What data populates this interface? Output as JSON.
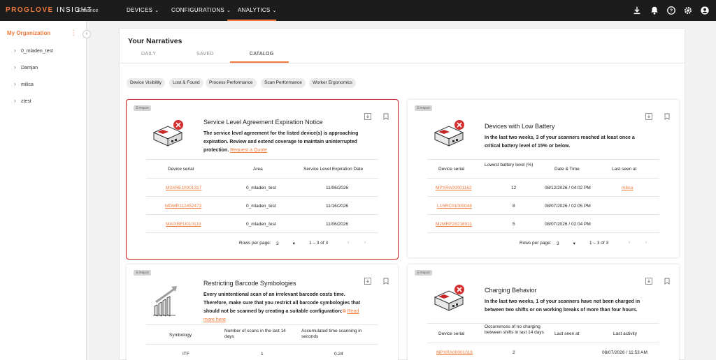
{
  "app": {
    "brand_main": "PROGLOVE",
    "brand_second": "INSIGHT",
    "brand_sub": "Enhance",
    "nav": [
      {
        "label": "DEVICES"
      },
      {
        "label": "CONFIGURATIONS"
      },
      {
        "label": "ANALYTICS"
      }
    ],
    "top_icons": [
      "download-icon",
      "bell-icon",
      "help-icon",
      "gear-icon",
      "user-icon"
    ]
  },
  "sidebar": {
    "org_title": "My Organization",
    "items": [
      {
        "label": "0_mladen_test"
      },
      {
        "label": "Damjan"
      },
      {
        "label": "milica"
      },
      {
        "label": "ztest"
      }
    ]
  },
  "main": {
    "title": "Your Narratives",
    "tabs": [
      {
        "label": "DAILY"
      },
      {
        "label": "SAVED"
      },
      {
        "label": "CATALOG"
      }
    ],
    "chips": [
      "Device Visibility",
      "Lost & Found",
      "Process Performance",
      "Scan Performance",
      "Worker Ergonomics"
    ]
  },
  "cards": {
    "badge": "Report",
    "sla": {
      "title": "Service Level Agreement Expiration Notice",
      "desc_line1": "The service level agreement for the listed device(s) is approaching",
      "desc_line2": "expiration. Review and extend coverage to maintain uninterrupted",
      "desc_line3": "protection.",
      "link": "Request a Quote",
      "columns": [
        "Device serial",
        "Area",
        "Service Level Expiration Date"
      ],
      "rows": [
        {
          "serial": "M3XRE10001317",
          "area": "0_mladen_test",
          "date": "11/06/2026"
        },
        {
          "serial": "MDMR112452473",
          "area": "0_mladen_test",
          "date": "11/16/2026"
        },
        {
          "serial": "MAIXBEU010119",
          "area": "0_mladen_test",
          "date": "11/06/2026"
        }
      ],
      "rows_per_page_label": "Rows per page:",
      "rows_per_page": "3",
      "range": "1 – 3 of 3"
    },
    "battery": {
      "title": "Devices with Low Battery",
      "desc_line1": "In the last two weeks, 3 of your scanners reached at least once a",
      "desc_line2": "critical battery level of 15% or below.",
      "columns": [
        "Device serial",
        "Lowest battery level (%)",
        "Date & Time",
        "Last seen at"
      ],
      "rows": [
        {
          "serial": "MPXRA00001162",
          "level": "12",
          "datetime": "08/12/2026 / 04:02 PM",
          "seen": "milica"
        },
        {
          "serial": "L1SRC01000048",
          "level": "8",
          "datetime": "08/07/2026 / 02:05 PM",
          "seen": ""
        },
        {
          "serial": "M2MRP28218911",
          "level": "5",
          "datetime": "08/07/2026 / 02:04 PM",
          "seen": ""
        }
      ],
      "rows_per_page_label": "Rows per page:",
      "rows_per_page": "3",
      "range": "1 – 3 of 3"
    },
    "barcode": {
      "title": "Restricting Barcode Symbologies",
      "desc_line1": "Every unintentional scan of an irrelevant barcode costs time.",
      "desc_line2": "Therefore, make sure that you restrict all barcode symbologies that",
      "desc_line3": "should not be scanned by creating a suitable configuration:",
      "link1": "Read",
      "link2": "more here",
      "columns": [
        "Symbology",
        "Number of scans in the last 14 days",
        "Accumulated time scanning in seconds"
      ],
      "rows": [
        {
          "symbology": "ITF",
          "scans": "1",
          "time": "0.24"
        }
      ]
    },
    "charging": {
      "title": "Charging Behavior",
      "desc_line1": "In the last two weeks, 1 of your scanners have not been charged in",
      "desc_line2": "between two shifts or on working breaks of more than four hours.",
      "columns": [
        "Device serial",
        "Occurrences of no charging between shifts in last 14 days",
        "Last seen at",
        "Last activity"
      ],
      "rows": [
        {
          "serial": "MPXRA00001016",
          "count": "2",
          "seen": "",
          "activity": "08/07/2026 / 11:53 AM"
        }
      ]
    }
  },
  "colors": {
    "accent": "#f07a3a",
    "topbar": "#1c1c1c",
    "selection": "#d11f1f",
    "error": "#d32f2f"
  }
}
